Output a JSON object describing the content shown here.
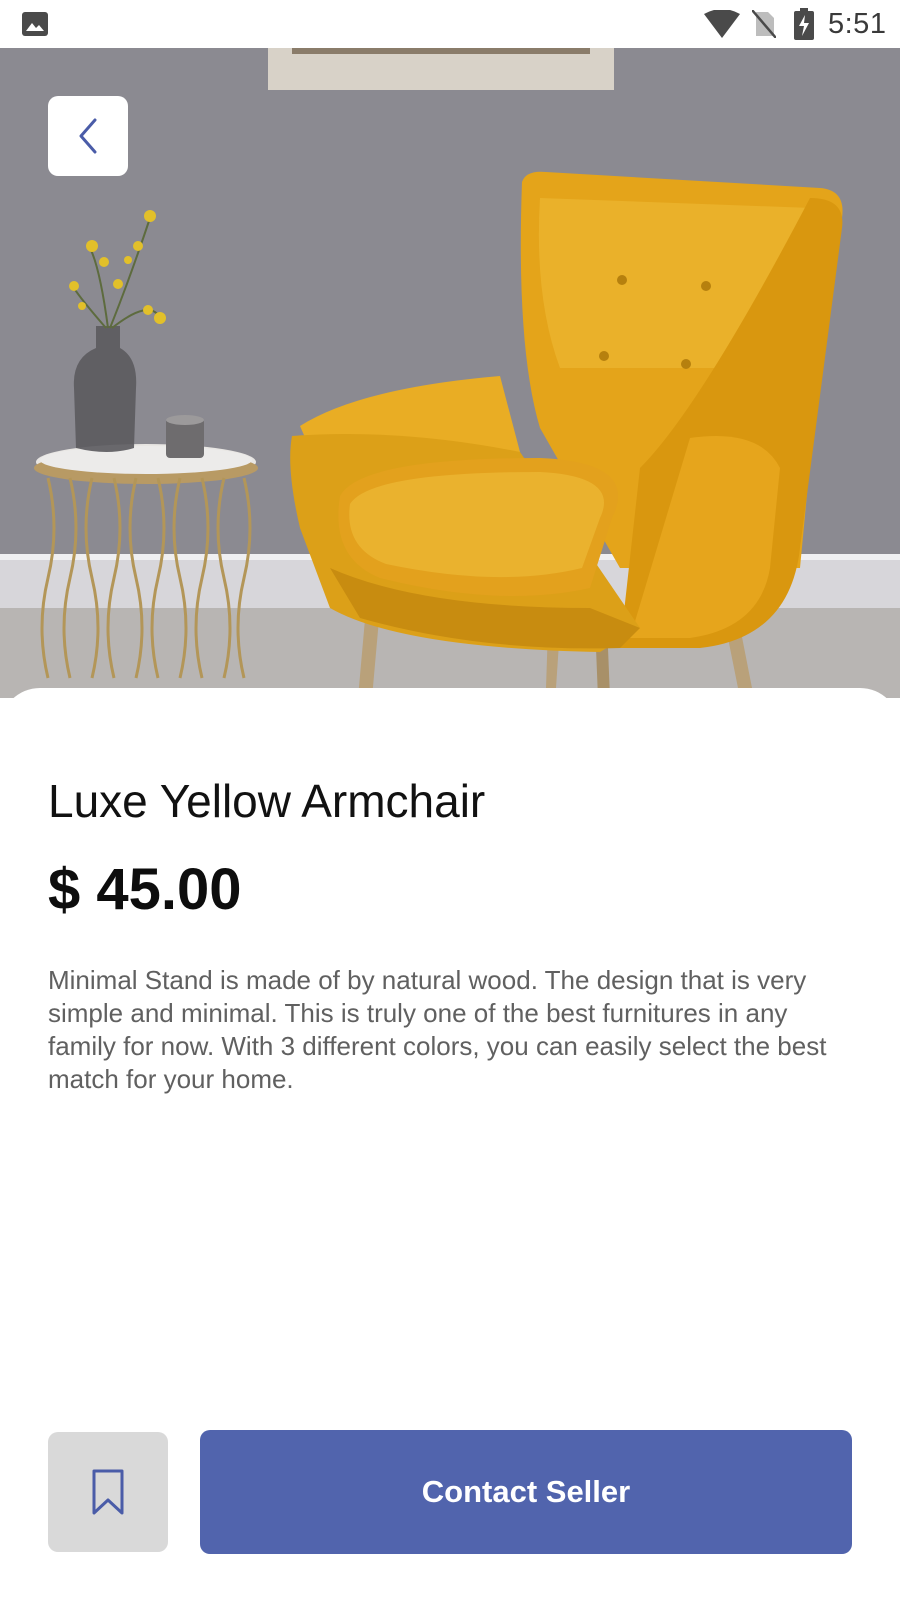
{
  "status_bar": {
    "time": "5:51",
    "icons": [
      "gallery-icon",
      "wifi-icon",
      "no-sim-icon",
      "battery-charging-icon"
    ]
  },
  "hero": {
    "image": "yellow-armchair-photo"
  },
  "navigation": {
    "back_icon": "chevron-left-icon"
  },
  "product": {
    "title": "Luxe Yellow Armchair",
    "price": "$ 45.00",
    "description": "Minimal Stand is made of by natural wood. The design that is very simple and minimal. This is truly one of the best furnitures in any family for now. With 3 different colors, you can easily select the best match for your home."
  },
  "actions": {
    "bookmark_icon": "bookmark-icon",
    "contact_label": "Contact Seller"
  },
  "colors": {
    "accent": "#5164ad",
    "bookmark_bg": "#d9d9d9",
    "title_text": "#111111",
    "body_text": "#606060"
  }
}
